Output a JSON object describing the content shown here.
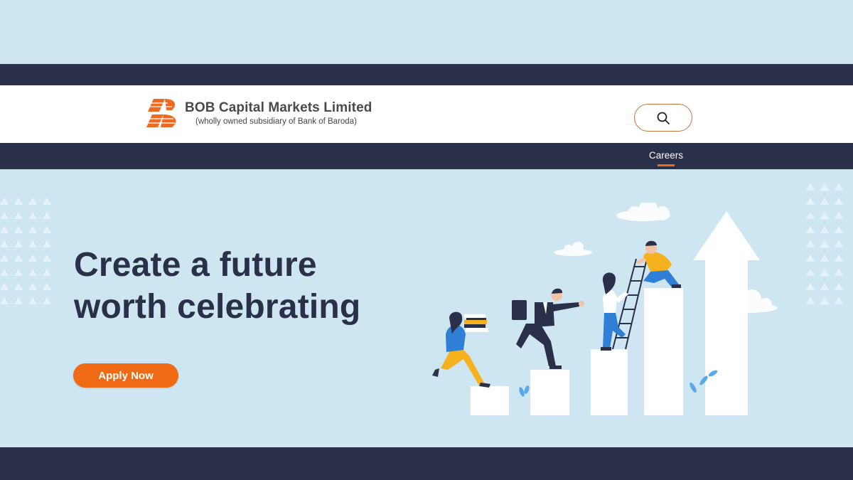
{
  "brand": {
    "name": "BOB Capital Markets Limited",
    "subtitle": "(wholly owned subsidiary of Bank of Baroda)",
    "logo_icon": "bank-of-baroda-logo",
    "accent_color": "#f06a14",
    "dark_color": "#2a3049"
  },
  "header": {
    "search_icon": "search-icon"
  },
  "nav": {
    "items": [
      {
        "label": "Careers",
        "active": true
      }
    ]
  },
  "hero": {
    "title_line1": "Create a future",
    "title_line2": "worth celebrating",
    "cta_label": "Apply Now"
  }
}
